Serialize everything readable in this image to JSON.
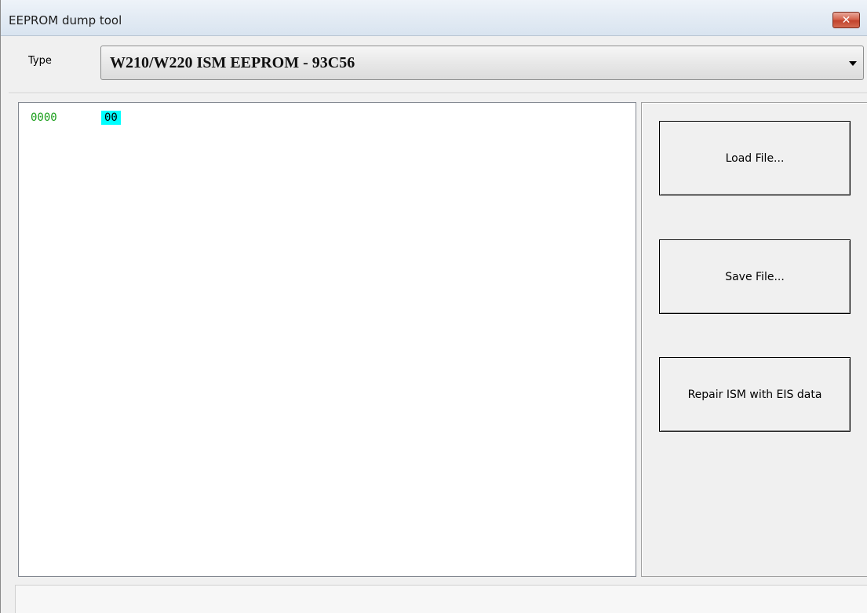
{
  "window": {
    "title": "EEPROM dump tool",
    "close_glyph": "✕"
  },
  "type": {
    "label": "Type",
    "selected": "W210/W220 ISM EEPROM - 93C56"
  },
  "hex_view": {
    "rows": [
      {
        "offset": "0000",
        "bytes": [
          "00"
        ]
      }
    ]
  },
  "actions": {
    "load": "Load File...",
    "save": "Save File...",
    "repair": "Repair ISM with EIS data"
  },
  "status": {
    "text": ""
  },
  "colors": {
    "offset": "#1a9e1a",
    "selected_byte_bg": "#00ffff"
  }
}
